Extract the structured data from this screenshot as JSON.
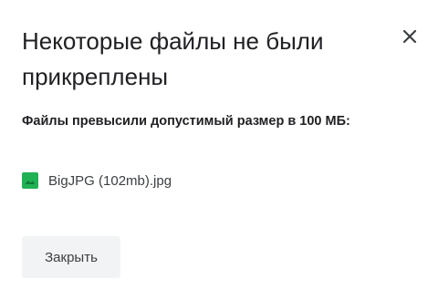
{
  "dialog": {
    "title": "Некоторые файлы не были прикреплены",
    "close_icon": "close-icon",
    "message": "Файлы превысили допустимый размер в 100 МБ:",
    "files": [
      {
        "name": "BigJPG (102mb).jpg",
        "icon": "image-file-icon",
        "icon_color": "#1fb154"
      }
    ],
    "close_button_label": "Закрыть"
  },
  "colors": {
    "text": "#202124",
    "secondary_text": "#3c4043",
    "button_background": "#f1f3f4"
  }
}
